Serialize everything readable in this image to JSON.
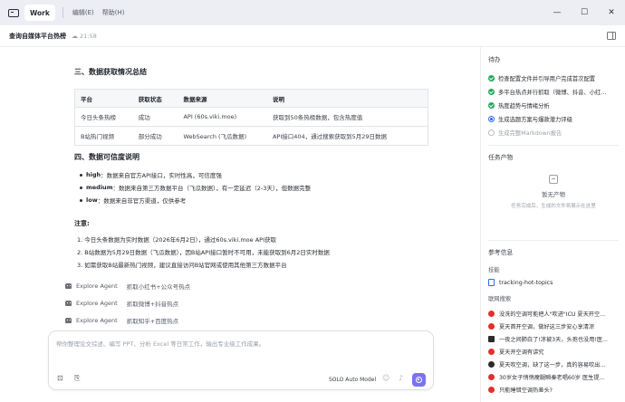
{
  "titlebar": {
    "tab": "Work",
    "menu": [
      "编辑(E)",
      "帮助(H)"
    ],
    "controls": [
      "—",
      "☐",
      "✕"
    ]
  },
  "header": {
    "title": "查询自媒体平台热榜",
    "time": "21:58"
  },
  "main": {
    "section3_title": "三、数据获取情况总结",
    "table": {
      "headers": [
        "平台",
        "获取状态",
        "数据来源",
        "说明"
      ],
      "rows": [
        [
          "今日头条热榜",
          "成功",
          "API (60s.viki.moe)",
          "获取到50条热榜数据，包含热度值"
        ],
        [
          "B站热门视频",
          "部分成功",
          "WebSearch (飞瓜数据)",
          "API接口404，通过搜索获取到5月29日数据"
        ]
      ]
    },
    "section4_title": "四、数据可信度说明",
    "bullets": [
      {
        "key": "high",
        "text": "：数据来自官方API接口，实时性高，可信度强"
      },
      {
        "key": "medium",
        "text": "：数据来自第三方数据平台（飞瓜数据），有一定延迟（2-3天），但数据完整"
      },
      {
        "key": "low",
        "text": "：数据来自非官方渠道，仅供参考"
      }
    ],
    "note_title": "注意:",
    "notes": [
      "1. 今日头条数据为实时数据（2026年6月2日），通过60s.viki.moe API获取",
      "2. B站数据为5月29日数据（飞瓜数据），因B站API接口暂时不可用，未能获取到6月2日实时数据",
      "3. 如需获取B站最新热门视频，建议直接访问B站官网或使用其他第三方数据平台"
    ],
    "agents": [
      {
        "name": "Explore Agent",
        "desc": "抓取小红书+公众号热点"
      },
      {
        "name": "Explore Agent",
        "desc": "抓取微博+抖音热点"
      },
      {
        "name": "Explore Agent",
        "desc": "抓取知乎+百度热点"
      }
    ],
    "input": {
      "placeholder": "帮你整理论文综述、编写 PPT、分析 Excel 等日常工作，输出专业级工作成果。",
      "model": "SOLO Auto Model"
    }
  },
  "panel": {
    "todo_title": "待办",
    "todos": [
      {
        "label": "检查配置文件并引导用户完成首次配置",
        "status": "done"
      },
      {
        "label": "多平台热点并行抓取（微博、抖音、小红...",
        "status": "done"
      },
      {
        "label": "热度趋势与情绪分析",
        "status": "done"
      },
      {
        "label": "生成选题方案与爆款潜力评级",
        "status": "in_progress"
      },
      {
        "label": "生成完整Markdown报告",
        "status": "pending"
      }
    ],
    "artifacts_title": "任务产物",
    "empty_title": "暂无产物",
    "empty_desc": "任务完成后，生成的文件将展示在这里",
    "ref_title": "参考信息",
    "skills_label": "技能",
    "skill": "tracking-hot-topics",
    "search_label": "联网搜索",
    "search_results": [
      {
        "text": "没洗的空调可能把人\"吹进\"ICU 夏天开空...",
        "color": "red"
      },
      {
        "text": "夏天首开空调，做好这三步安心享清凉",
        "color": "red"
      },
      {
        "text": "一夜之间肺白了!凉被3天，头孢也没用!医...",
        "color": "black"
      },
      {
        "text": "夏天开空调有讲究",
        "color": "red"
      },
      {
        "text": "夏天吹空调，缺了这一步，真的容易吹出...",
        "color": "black"
      },
      {
        "text": "30岁女子悄悄瘦腿瞬秦老唱60岁 医生提...",
        "color": "red"
      },
      {
        "text": "只能睡错空调热差头?",
        "color": "red"
      }
    ]
  }
}
